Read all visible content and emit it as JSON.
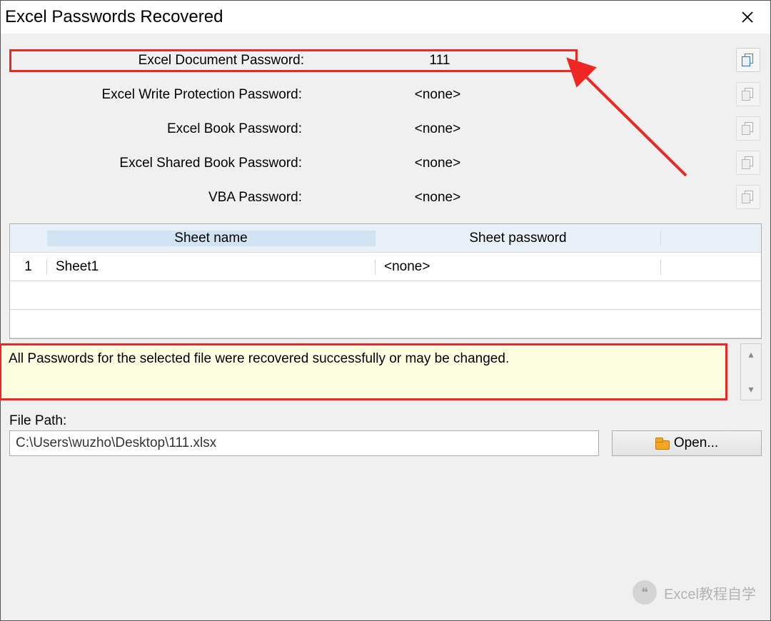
{
  "window": {
    "title": "Excel Passwords Recovered"
  },
  "passwords": {
    "rows": [
      {
        "label": "Excel Document Password:",
        "value": "111",
        "highlighted": true,
        "enabled": true
      },
      {
        "label": "Excel Write Protection Password:",
        "value": "<none>",
        "highlighted": false,
        "enabled": false
      },
      {
        "label": "Excel Book Password:",
        "value": "<none>",
        "highlighted": false,
        "enabled": false
      },
      {
        "label": "Excel Shared Book Password:",
        "value": "<none>",
        "highlighted": false,
        "enabled": false
      },
      {
        "label": "VBA Password:",
        "value": "<none>",
        "highlighted": false,
        "enabled": false
      }
    ]
  },
  "sheets": {
    "headers": {
      "name": "Sheet name",
      "password": "Sheet password"
    },
    "rows": [
      {
        "num": "1",
        "name": "Sheet1",
        "password": "<none>"
      }
    ]
  },
  "status": {
    "message": "All Passwords for the selected file were recovered successfully or may be changed."
  },
  "filepath": {
    "label": "File Path:",
    "value": "C:\\Users\\wuzho\\Desktop\\111.xlsx",
    "open_label": "Open..."
  },
  "watermark": {
    "text": "Excel教程自学"
  }
}
